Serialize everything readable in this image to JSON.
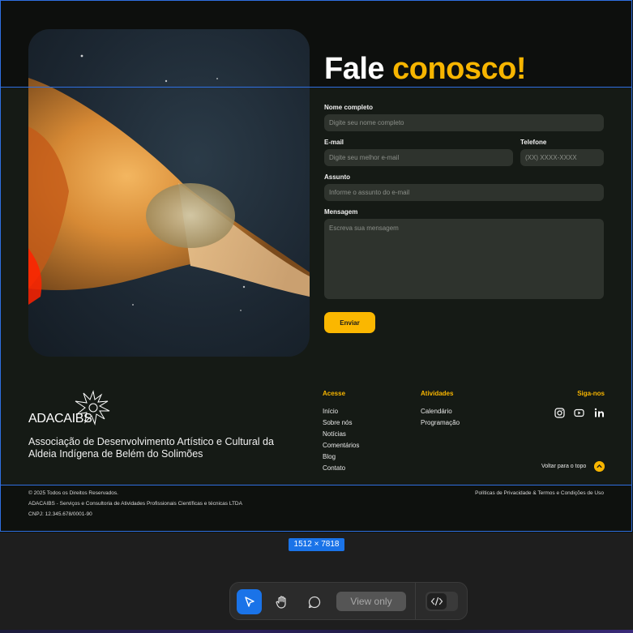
{
  "heading": {
    "part1": "Fale",
    "part2": "conosco!"
  },
  "form": {
    "name_label": "Nome completo",
    "name_placeholder": "Digite seu nome completo",
    "email_label": "E-mail",
    "email_placeholder": "Digite seu melhor e-mail",
    "phone_label": "Telefone",
    "phone_placeholder": "(XX) XXXX-XXXX",
    "subject_label": "Assunto",
    "subject_placeholder": "Informe o assunto do e-mail",
    "message_label": "Mensagem",
    "message_placeholder": "Escreva sua mensagem",
    "submit_label": "Enviar"
  },
  "footer": {
    "logo_text": "ADACAIBS",
    "association": "Associação de Desenvolvimento Artístico e Cultural da Aldeia Indígena de Belém do Solimões",
    "access": {
      "title": "Acesse",
      "items": [
        "Início",
        "Sobre nós",
        "Notícias",
        "Comentários",
        "Blog",
        "Contato"
      ]
    },
    "activities": {
      "title": "Atividades",
      "items": [
        "Calendário",
        "Programação"
      ]
    },
    "social": {
      "title": "Siga-nos",
      "icons": [
        "instagram-icon",
        "youtube-icon",
        "linkedin-icon"
      ]
    },
    "back_to_top": "Voltar para o topo",
    "copyright": "© 2025 Todos os Direitos Reservados.",
    "company": "ADACAIBS - Serviços e Consultoria de Atividades Profissionais Científicas e técnicas LTDA",
    "cnpj": "CNPJ: 12.345.678/0001-90",
    "policies": "Políticas de Privacidade & Termos e Condições de Uso"
  },
  "editor": {
    "size_badge": "1512 × 7818",
    "view_only": "View only"
  },
  "colors": {
    "accent": "#f7b500",
    "selection": "#1a73e8",
    "background": "#151a15"
  }
}
